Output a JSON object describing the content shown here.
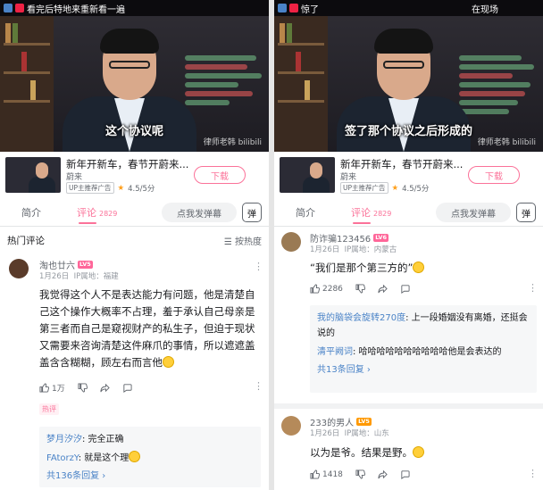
{
  "left": {
    "video": {
      "top_text": "看完后特地来重新看一遍",
      "subtitle": "这个协议呢",
      "watermark": "律师老韩 bilibili"
    },
    "card": {
      "title": "新年开新车，春节开蔚来...",
      "author": "蔚来",
      "tag": "UP主推荐广告",
      "rating": "4.5/5分",
      "download": "下载"
    },
    "tabs": {
      "intro": "简介",
      "comments": "评论",
      "comment_count": "2829",
      "danmu_placeholder": "点我发弹幕",
      "danmu_toggle": "弹"
    },
    "hot_title": "热门评论",
    "sort_label": "按热度",
    "comment": {
      "user": "淘也廿六",
      "level": "LV5",
      "date": "1月26日",
      "ip": "IP属地：福建",
      "text": "我觉得这个人不是表达能力有问题，他是清楚自己这个操作大概率不占理，羞于承认自己母亲是第三者而自己是窥视财产的私生子，但迫于现状又需要来咨询清楚这件麻爪的事情，所以遮遮盖盖含含糊糊，顾左右而言他",
      "likes": "1万",
      "hot_badge": "热评",
      "replies": [
        {
          "name": "梦月汐汐",
          "text": ": 完全正确"
        },
        {
          "name": "FAtorzY",
          "text": ": 就是这个理"
        }
      ],
      "reply_count": "共136条回复"
    }
  },
  "right": {
    "video": {
      "top_text": "惊了",
      "top_right": "在现场",
      "subtitle": "签了那个协议之后形成的",
      "watermark": "律师老韩 bilibili"
    },
    "card": {
      "title": "新年开新车，春节开蔚来...",
      "author": "蔚来",
      "tag": "UP主推荐广告",
      "rating": "4.5/5分",
      "download": "下载"
    },
    "tabs": {
      "intro": "简介",
      "comments": "评论",
      "comment_count": "2829",
      "danmu_placeholder": "点我发弹幕",
      "danmu_toggle": "弹"
    },
    "comment1": {
      "user": "防诈骗123456",
      "level": "LV6",
      "date": "1月26日",
      "ip": "IP属地：内蒙古",
      "text": "“我们是那个第三方的”",
      "likes": "2286",
      "replies": [
        {
          "name": "我的脑袋会旋转270度",
          "text": ": 上一段婚姻没有离婚，还挺会说的"
        },
        {
          "name": "清平阙词",
          "text": ": 哈哈哈哈哈哈哈哈哈哈他是会表达的"
        }
      ],
      "reply_count": "共13条回复"
    },
    "comment2": {
      "user": "233的男人",
      "level": "LV5",
      "date": "1月26日",
      "ip": "IP属地：山东",
      "text": "以为是爷。结果是野。",
      "likes": "1418"
    }
  },
  "colors": {
    "accent": "#fb7299",
    "link": "#4a83c7",
    "level": "#ff6699"
  }
}
